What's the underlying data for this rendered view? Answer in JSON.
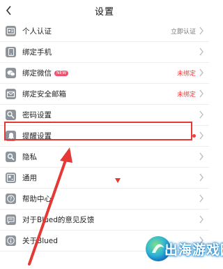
{
  "header": {
    "title": "设置"
  },
  "rows": [
    {
      "label": "个人认证",
      "right": "立即认证",
      "right_color": "gray",
      "icon": "id-card-icon"
    },
    {
      "label": "绑定手机",
      "icon": "phone-icon"
    },
    {
      "label": "绑定微信",
      "badge": "NEW",
      "right": "未绑定",
      "right_color": "red",
      "icon": "wechat-icon"
    },
    {
      "label": "绑定安全邮箱",
      "right": "未绑定",
      "right_color": "red",
      "icon": "mail-icon"
    },
    {
      "label": "密码设置",
      "icon": "key-icon"
    },
    {
      "label": "提醒设置",
      "dot": true,
      "icon": "bell-icon"
    },
    {
      "label": "隐私",
      "icon": "privacy-icon",
      "highlighted": true
    },
    {
      "label": "通用",
      "icon": "general-icon"
    },
    {
      "label": "帮助中心",
      "icon": "help-icon"
    },
    {
      "label": "对于Blued的意见反馈",
      "icon": "feedback-icon"
    },
    {
      "label": "关于Blued",
      "icon": "info-icon"
    }
  ],
  "watermark": {
    "text": "出海游戏园"
  },
  "colors": {
    "accent_red": "#f03e3e",
    "icon_gray": "#8d949c",
    "annotation": "#e53935"
  }
}
